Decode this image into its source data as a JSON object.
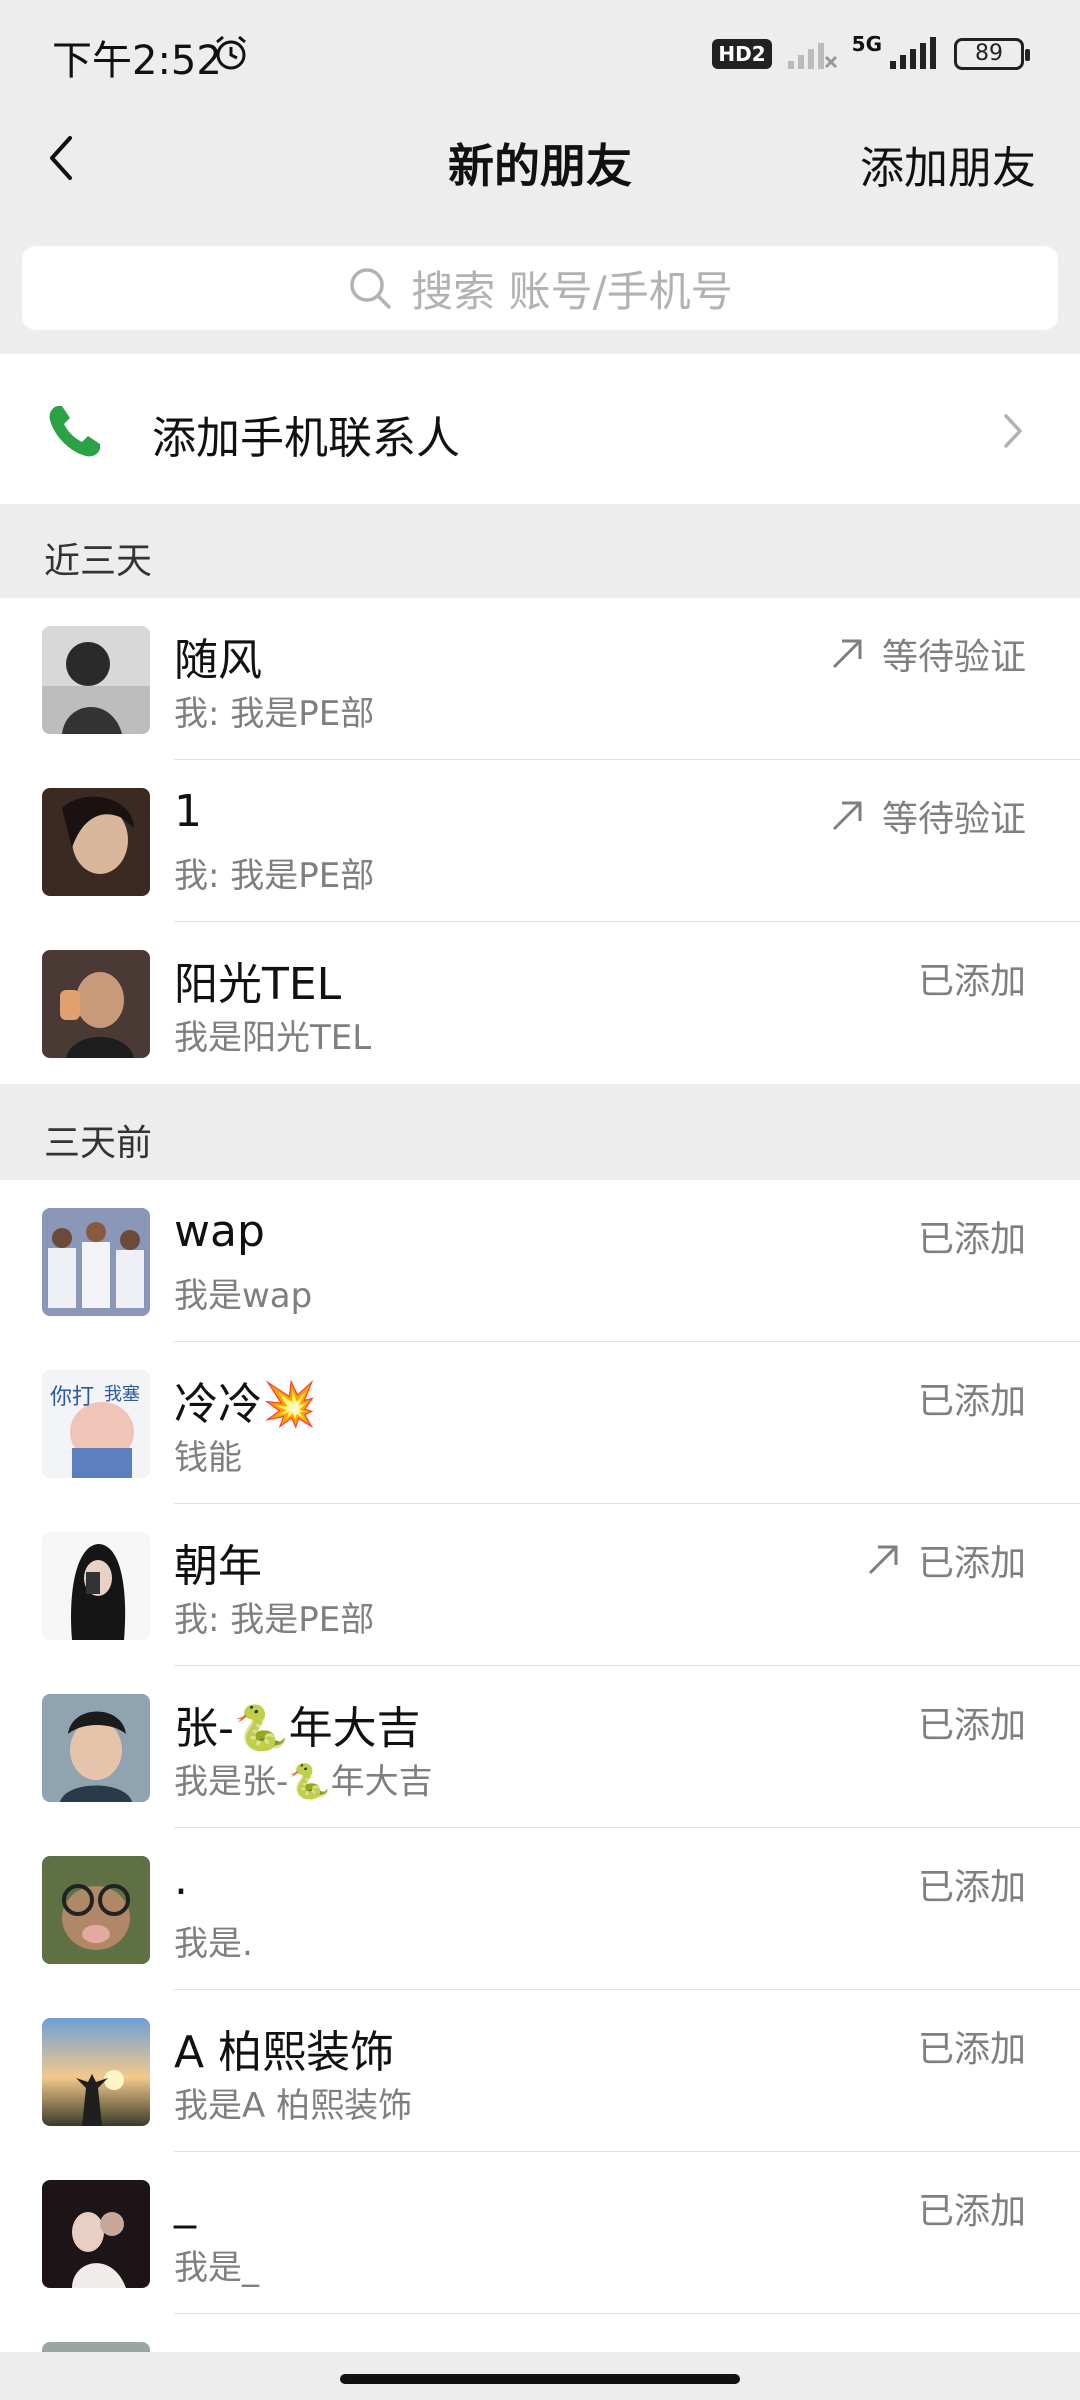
{
  "status_bar": {
    "time": "下午2:52",
    "hd": "HD2",
    "network": "5G",
    "battery": "89"
  },
  "header": {
    "title": "新的朋友",
    "add_friend": "添加朋友"
  },
  "search": {
    "placeholder": "搜索 账号/手机号"
  },
  "phone_contacts": {
    "label": "添加手机联系人"
  },
  "sections": [
    {
      "label": "近三天",
      "items": [
        {
          "name": "随风",
          "message": "我: 我是PE部",
          "status": "等待验证",
          "arrow": true
        },
        {
          "name": "1",
          "message": "我: 我是PE部",
          "status": "等待验证",
          "arrow": true
        },
        {
          "name": "阳光TEL",
          "message": "我是阳光TEL",
          "status": "已添加",
          "arrow": false
        }
      ]
    },
    {
      "label": "三天前",
      "items": [
        {
          "name": "wap",
          "message": "我是wap",
          "status": "已添加",
          "arrow": false
        },
        {
          "name": "冷冷💥",
          "message": "钱能",
          "status": "已添加",
          "arrow": false
        },
        {
          "name": "朝年",
          "message": "我: 我是PE部",
          "status": "已添加",
          "arrow": true
        },
        {
          "name": "张-🐍年大吉",
          "message": "我是张-🐍年大吉",
          "status": "已添加",
          "arrow": false
        },
        {
          "name": ".",
          "message": "我是.",
          "status": "已添加",
          "arrow": false
        },
        {
          "name": "A 柏熙装饰",
          "message": "我是A 柏熙装饰",
          "status": "已添加",
          "arrow": false
        },
        {
          "name": "_",
          "message": "我是_",
          "status": "已添加",
          "arrow": false
        }
      ]
    }
  ],
  "colors": {
    "accent_green": "#2ba245",
    "background": "#ededed",
    "secondary_text": "#7f7f7f"
  },
  "icons": [
    "alarm-icon",
    "back-arrow-icon",
    "search-icon",
    "phone-icon",
    "chevron-right-icon",
    "outgoing-arrow-icon"
  ]
}
